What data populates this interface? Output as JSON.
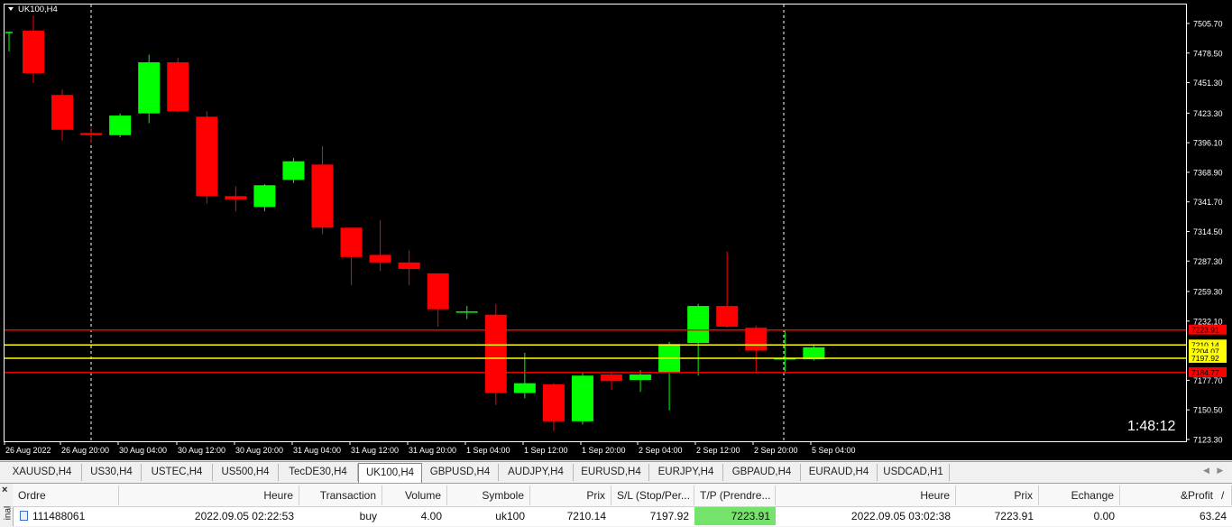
{
  "chart": {
    "symbol_label": "UK100,H4",
    "countdown": "1:48:12",
    "price_labels": [
      "7505.70",
      "7478.50",
      "7451.30",
      "7423.30",
      "7396.10",
      "7368.90",
      "7341.70",
      "7314.50",
      "7287.30",
      "7259.30",
      "7232.10",
      "7177.70",
      "7150.50",
      "7123.30"
    ],
    "time_labels": [
      "26 Aug 2022",
      "26 Aug 20:00",
      "30 Aug 04:00",
      "30 Aug 12:00",
      "30 Aug 20:00",
      "31 Aug 04:00",
      "31 Aug 12:00",
      "31 Aug 20:00",
      "1 Sep 04:00",
      "1 Sep 12:00",
      "1 Sep 20:00",
      "2 Sep 04:00",
      "2 Sep 12:00",
      "2 Sep 20:00",
      "5 Sep 04:00"
    ],
    "level_labels": {
      "tp": "7223.91",
      "open": "7210.14",
      "hidden": "7204.07",
      "sl": "7197.92",
      "low": "7184.77"
    },
    "colors": {
      "bull": "#00ff00",
      "bear": "#ff0000",
      "background": "#000000",
      "red_line": "#ff0000",
      "yellow_line": "#ffff00"
    },
    "candles": [
      {
        "o": 7498,
        "h": 7498,
        "l": 7480,
        "c": 7498
      },
      {
        "o": 7499,
        "h": 7513,
        "l": 7451,
        "c": 7460
      },
      {
        "o": 7440,
        "h": 7445,
        "l": 7398,
        "c": 7408
      },
      {
        "o": 7405,
        "h": 7410,
        "l": 7396,
        "c": 7403
      },
      {
        "o": 7403,
        "h": 7423,
        "l": 7401,
        "c": 7421
      },
      {
        "o": 7423,
        "h": 7477,
        "l": 7414,
        "c": 7470
      },
      {
        "o": 7470,
        "h": 7474,
        "l": 7424,
        "c": 7425
      },
      {
        "o": 7420,
        "h": 7425,
        "l": 7340,
        "c": 7347
      },
      {
        "o": 7347,
        "h": 7356,
        "l": 7333,
        "c": 7344
      },
      {
        "o": 7337,
        "h": 7358,
        "l": 7333,
        "c": 7357
      },
      {
        "o": 7362,
        "h": 7382,
        "l": 7359,
        "c": 7379
      },
      {
        "o": 7376,
        "h": 7393,
        "l": 7312,
        "c": 7318
      },
      {
        "o": 7318,
        "h": 7318,
        "l": 7265,
        "c": 7291
      },
      {
        "o": 7293,
        "h": 7325,
        "l": 7278,
        "c": 7286
      },
      {
        "o": 7286,
        "h": 7297,
        "l": 7265,
        "c": 7280
      },
      {
        "o": 7276,
        "h": 7276,
        "l": 7227,
        "c": 7243
      },
      {
        "o": 7240,
        "h": 7246,
        "l": 7234,
        "c": 7241
      },
      {
        "o": 7238,
        "h": 7248,
        "l": 7155,
        "c": 7166
      },
      {
        "o": 7166,
        "h": 7203,
        "l": 7161,
        "c": 7175
      },
      {
        "o": 7174,
        "h": 7175,
        "l": 7131,
        "c": 7140
      },
      {
        "o": 7140,
        "h": 7185,
        "l": 7137,
        "c": 7182
      },
      {
        "o": 7183,
        "h": 7185,
        "l": 7169,
        "c": 7177
      },
      {
        "o": 7178,
        "h": 7187,
        "l": 7167,
        "c": 7183
      },
      {
        "o": 7185,
        "h": 7213,
        "l": 7150,
        "c": 7211
      },
      {
        "o": 7212,
        "h": 7248,
        "l": 7182,
        "c": 7246
      },
      {
        "o": 7246,
        "h": 7296,
        "l": 7226,
        "c": 7227
      },
      {
        "o": 7226,
        "h": 7228,
        "l": 7185,
        "c": 7205
      },
      {
        "o": 7198,
        "h": 7224,
        "l": 7184,
        "c": 7198
      },
      {
        "o": 7197,
        "h": 7211,
        "l": 7196,
        "c": 7208
      }
    ]
  },
  "tabs": [
    "XAUUSD,H4",
    "US30,H4",
    "USTEC,H4",
    "US500,H4",
    "TecDE30,H4",
    "UK100,H4",
    "GBPUSD,H4",
    "AUDJPY,H4",
    "EURUSD,H4",
    "EURJPY,H4",
    "GBPAUD,H4",
    "EURAUD,H4",
    "USDCAD,H1"
  ],
  "active_tab": "UK100,H4",
  "terminal": {
    "close_label": "×",
    "side_label": "inal",
    "headers": [
      "Ordre",
      "Heure",
      "Transaction",
      "Volume",
      "Symbole",
      "Prix",
      "S/L (Stop/Per...",
      "T/P (Prendre...",
      "Heure",
      "Prix",
      "Echange",
      "&Profit"
    ],
    "sort_mark": "/",
    "row": [
      "111488061",
      "2022.09.05 02:22:53",
      "buy",
      "4.00",
      "uk100",
      "7210.14",
      "7197.92",
      "7223.91",
      "2022.09.05 03:02:38",
      "7223.91",
      "0.00",
      "63.24"
    ]
  }
}
